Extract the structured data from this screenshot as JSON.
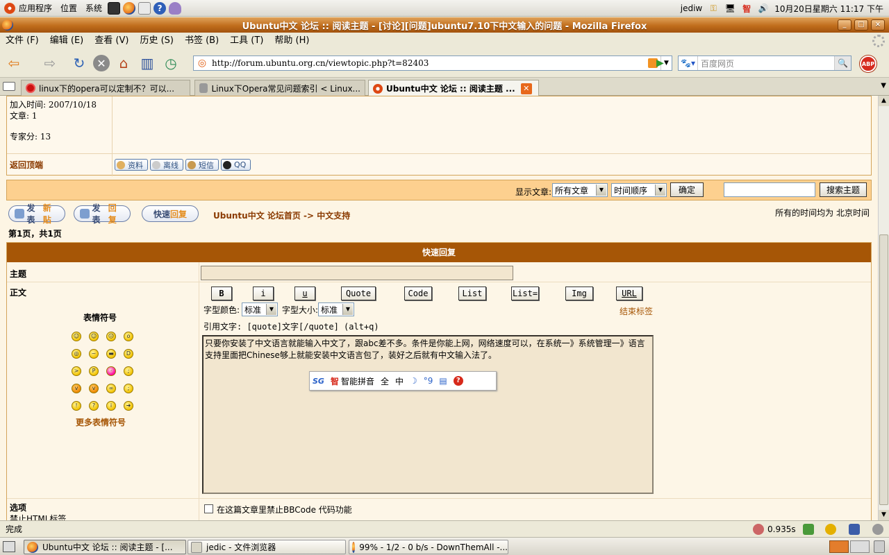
{
  "top_panel": {
    "menus": [
      "应用程序",
      "位置",
      "系统"
    ],
    "username": "jediw",
    "ime_indicator": "智",
    "datetime": "10月20日星期六 11:17 下午"
  },
  "window": {
    "title": "Ubuntu中文 论坛 :: 阅读主题 - [讨论][问题]ubuntu7.10下中文输入的问题 - Mozilla Firefox",
    "buttons": [
      "_",
      "□",
      "×"
    ]
  },
  "menubar": [
    "文件 (F)",
    "编辑 (E)",
    "查看 (V)",
    "历史 (S)",
    "书签 (B)",
    "工具 (T)",
    "帮助 (H)"
  ],
  "navbar": {
    "url": "http://forum.ubuntu.org.cn/viewtopic.php?t=82403",
    "search_placeholder": "百度网页",
    "adblock_label": "ABP"
  },
  "tabs": [
    {
      "label": "linux下的opera可以定制不？可以..."
    },
    {
      "label": "Linux下Opera常见问题索引 < Linux..."
    },
    {
      "label": "Ubuntu中文 论坛 :: 阅读主题 ..."
    }
  ],
  "post_tail": {
    "join_date": "加入时间: 2007/10/18",
    "posts": "文章: 1",
    "expert_points": "专家分: 13",
    "back_to_top": "返回顶端",
    "buttons": [
      "资料",
      "离线",
      "短信",
      "QQ"
    ]
  },
  "filter_bar": {
    "label": "显示文章:",
    "filter_value": "所有文章",
    "order_value": "时间顺序",
    "confirm_label": "确定",
    "search_label": "搜索主题"
  },
  "actions": {
    "new_topic": {
      "a": "发表",
      "b": "新贴"
    },
    "reply": {
      "a": "发表",
      "b": "回复"
    },
    "quick_reply": {
      "a": "快速",
      "b": "回复"
    },
    "breadcrumb": "Ubuntu中文 论坛首页 -> 中文支持",
    "timezone": "所有的时间均为 北京时间",
    "page_info": "第1页，共1页"
  },
  "quick_reply": {
    "header": "快速回复",
    "subject_label": "主题",
    "body_label": "正文",
    "smilies_title": "表情符号",
    "more_smilies": "更多表情符号",
    "bbcode_buttons": [
      "B",
      "i",
      "u",
      "Quote",
      "Code",
      "List",
      "List=",
      "Img",
      "URL"
    ],
    "font_color_label": "字型颜色:",
    "font_color_value": "标准",
    "font_size_label": "字型大小:",
    "font_size_value": "标准",
    "close_tags": "结束标签",
    "quote_hint": "引用文字: [quote]文字[/quote]  (alt+q)",
    "message": "只要你安装了中文语言就能输入中文了，跟abc差不多。条件是你能上网，网络速度可以，在系统一》系统管理一》语言支持里面把Chinese够上就能安装中文语言包了，装好之后就有中文输入法了。",
    "options_label": "选项",
    "options_sub": "禁止HTML标签",
    "option_bbcode": "在这篇文章里禁止BBCode 代码功能"
  },
  "ime_bar": {
    "logo": "SG",
    "name_icon": "智",
    "name": "智能拼音",
    "full_width": "全",
    "chinese": "中",
    "moon": "☽",
    "punct": "°9",
    "keyboard": "▤",
    "help": "?"
  },
  "statusbar": {
    "text": "完成",
    "timer": "0.935s"
  },
  "taskbar": [
    {
      "label": "Ubuntu中文 论坛 :: 阅读主题 - [..."
    },
    {
      "label": "jedic - 文件浏览器"
    },
    {
      "label": "99% - 1/2 - 0 b/s - DownThemAll -..."
    }
  ]
}
